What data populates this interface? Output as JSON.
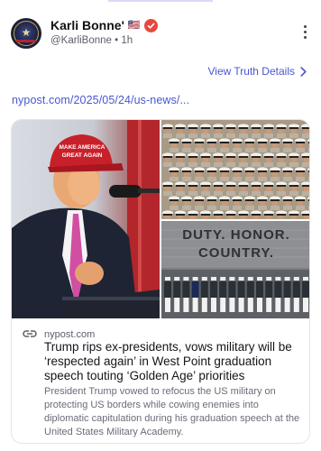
{
  "post": {
    "display_name": "Karli Bonne'",
    "flag": "🇺🇸",
    "handle": "@KarliBonne",
    "separator": "•",
    "time": "1h",
    "view_details": "View Truth Details",
    "link": "nypost.com/2025/05/24/us-news/..."
  },
  "card": {
    "source": "nypost.com",
    "headline": "Trump rips ex-presidents, vows military will be ‘respected again’ in West Point graduation speech touting ‘Golden Age’ priorities",
    "description": "President Trump vowed to refocus the US military on protecting US borders while cowing enemies into diplomatic capitulation during his graduation speech at the United States Military Academy.",
    "images": {
      "hat_text_1": "MAKE AMERICA",
      "hat_text_2": "GREAT AGAIN",
      "banner_line_1": "DUTY. HONOR.",
      "banner_line_2": "COUNTRY."
    }
  },
  "colors": {
    "accent": "#4a56d1",
    "verified": "#e8473f"
  },
  "icons": {
    "verified": "verified-badge-icon",
    "more": "more-vertical-icon",
    "chevron": "chevron-right-icon",
    "link": "link-icon"
  }
}
